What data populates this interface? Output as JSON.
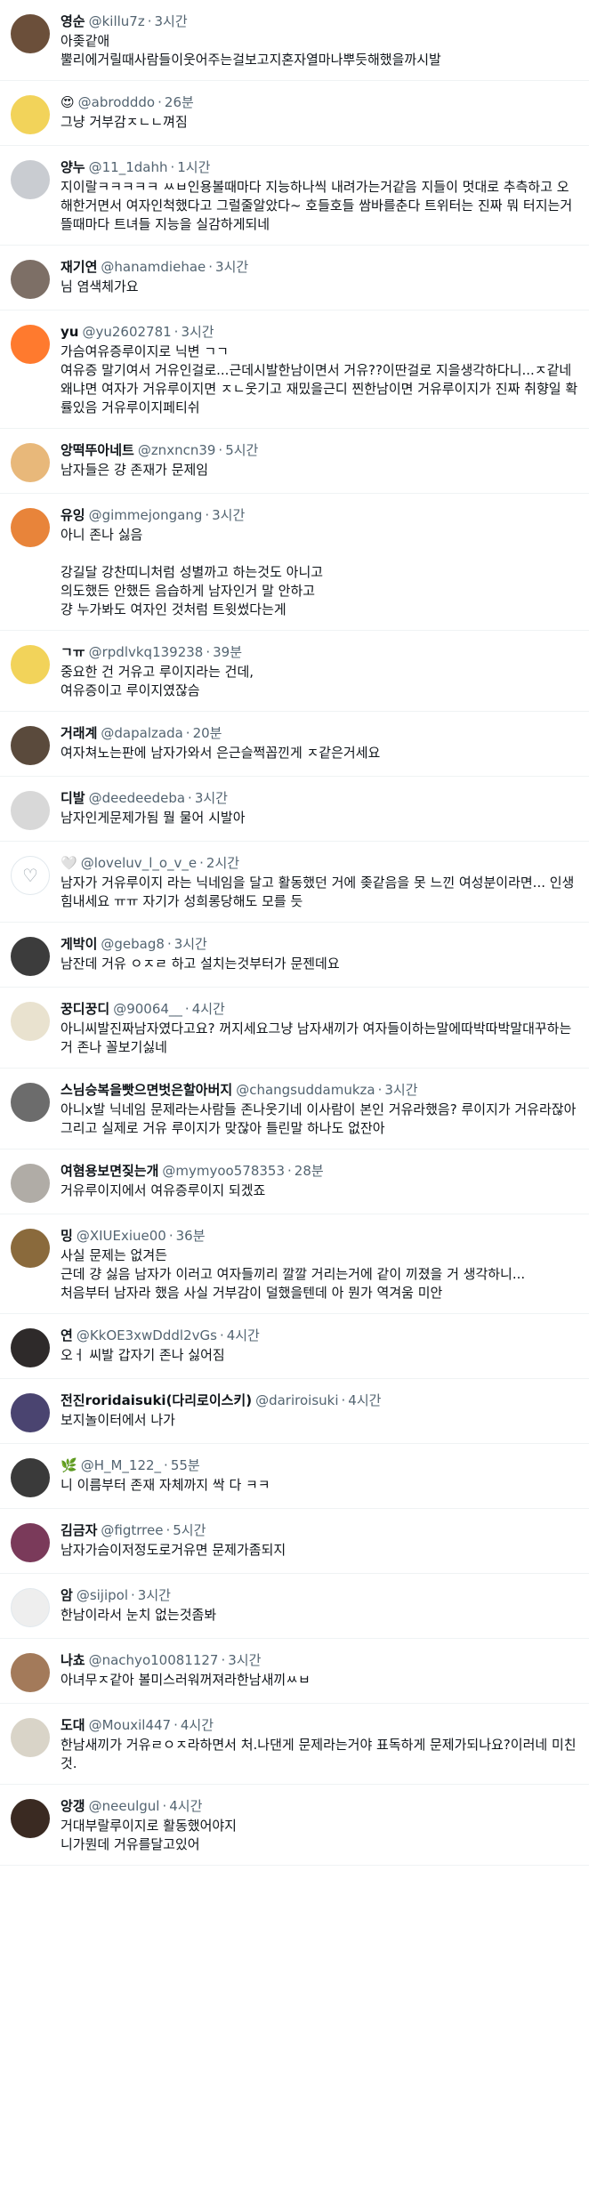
{
  "tweets": [
    {
      "name": "영순",
      "handle": "@killu7z",
      "time": "3시간",
      "avatar_color": "#6b4f3a",
      "avatar_glyph": "",
      "text": "아좆같애\n뿔리에거릴때사람들이웃어주는걸보고지혼자열마나뿌듯해했을까시발"
    },
    {
      "name": "😍",
      "handle": "@abrodddo",
      "time": "26분",
      "avatar_color": "#f2d35a",
      "avatar_glyph": "",
      "text": "그냥 거부감ㅈㄴㄴ껴짐"
    },
    {
      "name": "양누",
      "handle": "@11_1dahh",
      "time": "1시간",
      "avatar_color": "#c9ccd1",
      "avatar_glyph": "",
      "text": "지이랄ㅋㅋㅋㅋㅋ ㅆㅂ인용볼때마다 지능하나씩 내려가는거같음 지들이 멋대로 추측하고 오해한거면서 여자인척했다고 그럴줄알았다~ 호들호들 쌈바를춘다 트위터는 진짜 뭐 터지는거 뜰때마다 트녀들 지능을 실감하게되네"
    },
    {
      "name": "재기연",
      "handle": "@hanamdiehae",
      "time": "3시간",
      "avatar_color": "#7d6f66",
      "avatar_glyph": "",
      "text": "님 염색체가요"
    },
    {
      "name": "yu",
      "handle": "@yu2602781",
      "time": "3시간",
      "avatar_color": "#ff7a2e",
      "avatar_glyph": "",
      "text": "가슴여유증루이지로 닉변 ㄱㄱ\n여유증 말기여서 거유인걸로...근데시발한남이면서 거유??이딴걸로 지을생각하다니...ㅈ같네\n왜냐면 여자가 거유루이지면 ㅈㄴ웃기고 재밌을근디 찐한남이면 거유루이지가 진짜 취향일 확률있음 거유루이지페티쉬"
    },
    {
      "name": "앙떡뚜아네트",
      "handle": "@znxncn39",
      "time": "5시간",
      "avatar_color": "#e8b87a",
      "avatar_glyph": "",
      "text": "남자들은 걍 존재가 문제임"
    },
    {
      "name": "유잉",
      "handle": "@gimmejongang",
      "time": "3시간",
      "avatar_color": "#e8843a",
      "avatar_glyph": "",
      "text": "아니 존나 싫음\n\n강길달 강찬띠니처럼 성별까고 하는것도 아니고\n의도했든 안했든 음습하게 남자인거 말 안하고\n걍 누가봐도 여자인 것처럼 트윗썼다는게"
    },
    {
      "name": "ㄱㅠ",
      "handle": "@rpdlvkq139238",
      "time": "39분",
      "avatar_color": "#f2d35a",
      "avatar_glyph": "",
      "text": "중요한 건 거유고 루이지라는 건데,\n여유증이고 루이지였잖슴"
    },
    {
      "name": "거래계",
      "handle": "@dapalzada",
      "time": "20분",
      "avatar_color": "#5a4a3c",
      "avatar_glyph": "",
      "text": "여자쳐노는판에 남자가와서 은근슬쩍꼽낀게 ㅈ같은거세요"
    },
    {
      "name": "디발",
      "handle": "@deedeedeba",
      "time": "3시간",
      "avatar_color": "#d8d8d8",
      "avatar_glyph": "",
      "text": "남자인게문제가됨 뭘 물어 시발아"
    },
    {
      "name": "🤍",
      "handle": "@loveluv_l_o_v_e",
      "time": "2시간",
      "avatar_color": "#ffffff",
      "avatar_glyph": "♡",
      "text": "남자가 거유루이지 라는 닉네임을 달고 활동했던 거에 좆같음을 못 느낀 여성분이라면... 인생 힘내세요 ㅠㅠ 자기가 성희롱당해도 모를 듯"
    },
    {
      "name": "게박이",
      "handle": "@gebag8",
      "time": "3시간",
      "avatar_color": "#3c3c3c",
      "avatar_glyph": "",
      "text": "남잔데 거유 ㅇㅈㄹ 하고 설치는것부터가 문젠데요"
    },
    {
      "name": "꿍디꿍디",
      "handle": "@90064__",
      "time": "4시간",
      "avatar_color": "#e9e2cf",
      "avatar_glyph": "",
      "text": "아니씨발진짜남자였다고요? 꺼지세요그냥 남자새끼가 여자들이하는말에따박따박말대꾸하는거 존나 꼴보기싫네"
    },
    {
      "name": "스님승복을빳으면벗은할아버지",
      "handle": "@changsuddamukza",
      "time": "3시간",
      "avatar_color": "#6c6c6c",
      "avatar_glyph": "",
      "text": "아니x발 닉네임 문제라는사람들 존나웃기네 이사람이 본인 거유라했음? 루이지가 거유라잖아 그리고 실제로 거유 루이지가 맞잖아 틀린말 하나도 없잔아"
    },
    {
      "name": "여혐용보면짖는개",
      "handle": "@mymyoo578353",
      "time": "28분",
      "avatar_color": "#b0aca6",
      "avatar_glyph": "",
      "text": "거유루이지에서 여유증루이지 되겠죠"
    },
    {
      "name": "밍",
      "handle": "@XIUExiue00",
      "time": "36분",
      "avatar_color": "#8a6a3c",
      "avatar_glyph": "",
      "text": "사실 문제는 없겨든\n근데 걍 싫음 남자가 이러고 여자들끼리 깔깔 거리는거에 같이 끼졌을 거 생각하니...\n처음부터 남자라 했음 사실 거부감이 덜했을텐데 아 뭔가 역겨움 미안"
    },
    {
      "name": "연",
      "handle": "@KkOE3xwDddl2vGs",
      "time": "4시간",
      "avatar_color": "#2e2a2a",
      "avatar_glyph": "",
      "text": "오ㅓ 씨발 갑자기 존나 싫어짐"
    },
    {
      "name": "전진roridaisuki(다리로이스키)",
      "handle": "@dariroisuki",
      "time": "4시간",
      "avatar_color": "#4a4470",
      "avatar_glyph": "",
      "text": "보지놀이터에서 나가"
    },
    {
      "name": "🌿",
      "handle": "@H_M_122_",
      "time": "55분",
      "avatar_color": "#3a3a3a",
      "avatar_glyph": "",
      "text": "니 이름부터 존재 자체까지 싹 다 ㅋㅋ"
    },
    {
      "name": "김금자",
      "handle": "@figtrree",
      "time": "5시간",
      "avatar_color": "#7a3a5a",
      "avatar_glyph": "",
      "text": "남자가슴이저정도로거유면 문제가좀되지"
    },
    {
      "name": "암",
      "handle": "@sijipol",
      "time": "3시간",
      "avatar_color": "#eeeeee",
      "avatar_glyph": "",
      "text": "한남이라서 눈치 없는것좀봐"
    },
    {
      "name": "나쵸",
      "handle": "@nachyo10081127",
      "time": "3시간",
      "avatar_color": "#a37a5a",
      "avatar_glyph": "",
      "text": "아녀무ㅈ같아 볼미스러워꺼져라한남새끼ㅆㅂ"
    },
    {
      "name": "도대",
      "handle": "@Mouxil447",
      "time": "4시간",
      "avatar_color": "#d9d4c8",
      "avatar_glyph": "",
      "text": "한남새끼가 거유ㄹㅇㅈ라하면서 처.나댄게 문제라는거야 표독하게 문제가되나요?이러네 미친것."
    },
    {
      "name": "앙갱",
      "handle": "@neeulgul",
      "time": "4시간",
      "avatar_color": "#3a2a22",
      "avatar_glyph": "",
      "text": "거대부랄루이지로 활동했어야지\n니가뭔데 거유를달고있어"
    }
  ]
}
